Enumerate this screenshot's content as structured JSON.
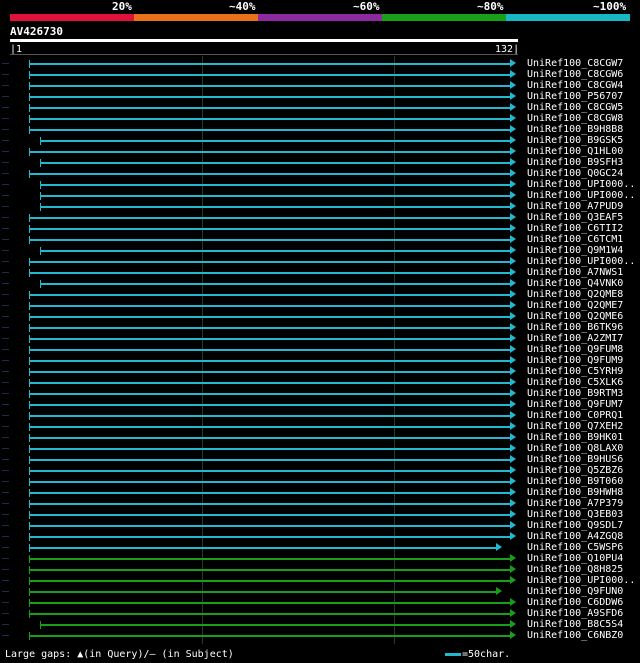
{
  "legend": {
    "labels": [
      "20%",
      "~40%",
      "~60%",
      "~80%",
      "~100%"
    ],
    "colors": [
      "#e0123c",
      "#e8711a",
      "#8e2aa0",
      "#18a118",
      "#17b7c5"
    ]
  },
  "query": {
    "id": "AV426730",
    "start": "1",
    "end": "132"
  },
  "hits": [
    {
      "label": "UniRef100_C8CGW7",
      "color": "cyan",
      "start": "near"
    },
    {
      "label": "UniRef100_C8CGW6",
      "color": "cyan",
      "start": "near"
    },
    {
      "label": "UniRef100_C8CGW4",
      "color": "cyan",
      "start": "near"
    },
    {
      "label": "UniRef100_P56707",
      "color": "cyan",
      "start": "near"
    },
    {
      "label": "UniRef100_C8CGW5",
      "color": "cyan",
      "start": "near"
    },
    {
      "label": "UniRef100_C8CGW8",
      "color": "cyan",
      "start": "near"
    },
    {
      "label": "UniRef100_B9H8B8",
      "color": "cyan",
      "start": "near"
    },
    {
      "label": "UniRef100_B9GSK5",
      "color": "cyan",
      "start": "far"
    },
    {
      "label": "UniRef100_Q1HL00",
      "color": "cyan",
      "start": "near"
    },
    {
      "label": "UniRef100_B9SFH3",
      "color": "cyan",
      "start": "far"
    },
    {
      "label": "UniRef100_Q0GC24",
      "color": "cyan",
      "start": "near"
    },
    {
      "label": "UniRef100_UPI000..",
      "color": "cyan",
      "start": "far"
    },
    {
      "label": "UniRef100_UPI000..",
      "color": "cyan",
      "start": "far"
    },
    {
      "label": "UniRef100_A7PUD9",
      "color": "cyan",
      "start": "far"
    },
    {
      "label": "UniRef100_Q3EAF5",
      "color": "cyan",
      "start": "near"
    },
    {
      "label": "UniRef100_C6TII2",
      "color": "cyan",
      "start": "near"
    },
    {
      "label": "UniRef100_C6TCM1",
      "color": "cyan",
      "start": "near"
    },
    {
      "label": "UniRef100_Q9M1W4",
      "color": "cyan",
      "start": "far"
    },
    {
      "label": "UniRef100_UPI000..",
      "color": "cyan",
      "start": "near"
    },
    {
      "label": "UniRef100_A7NWS1",
      "color": "cyan",
      "start": "near"
    },
    {
      "label": "UniRef100_Q4VNK0",
      "color": "cyan",
      "start": "far"
    },
    {
      "label": "UniRef100_Q2QME8",
      "color": "cyan",
      "start": "near"
    },
    {
      "label": "UniRef100_Q2QME7",
      "color": "cyan",
      "start": "near"
    },
    {
      "label": "UniRef100_Q2QME6",
      "color": "cyan",
      "start": "near"
    },
    {
      "label": "UniRef100_B6TK96",
      "color": "cyan",
      "start": "near"
    },
    {
      "label": "UniRef100_A2ZMI7",
      "color": "cyan",
      "start": "near"
    },
    {
      "label": "UniRef100_Q9FUM8",
      "color": "cyan",
      "start": "near"
    },
    {
      "label": "UniRef100_Q9FUM9",
      "color": "cyan",
      "start": "near"
    },
    {
      "label": "UniRef100_C5YRH9",
      "color": "cyan",
      "start": "near"
    },
    {
      "label": "UniRef100_C5XLK6",
      "color": "cyan",
      "start": "near"
    },
    {
      "label": "UniRef100_B9RTM3",
      "color": "cyan",
      "start": "near"
    },
    {
      "label": "UniRef100_Q9FUM7",
      "color": "cyan",
      "start": "near"
    },
    {
      "label": "UniRef100_C0PRQ1",
      "color": "cyan",
      "start": "near"
    },
    {
      "label": "UniRef100_Q7XEH2",
      "color": "cyan",
      "start": "near"
    },
    {
      "label": "UniRef100_B9HK01",
      "color": "cyan",
      "start": "near"
    },
    {
      "label": "UniRef100_Q8LAX0",
      "color": "cyan",
      "start": "near"
    },
    {
      "label": "UniRef100_B9HUS6",
      "color": "cyan",
      "start": "near"
    },
    {
      "label": "UniRef100_Q5ZBZ6",
      "color": "cyan",
      "start": "near"
    },
    {
      "label": "UniRef100_B9T060",
      "color": "cyan",
      "start": "near"
    },
    {
      "label": "UniRef100_B9HWH8",
      "color": "cyan",
      "start": "near"
    },
    {
      "label": "UniRef100_A7P379",
      "color": "cyan",
      "start": "near"
    },
    {
      "label": "UniRef100_Q3EB03",
      "color": "cyan",
      "start": "near"
    },
    {
      "label": "UniRef100_Q9SDL7",
      "color": "cyan",
      "start": "near"
    },
    {
      "label": "UniRef100_A4ZGQ8",
      "color": "cyan",
      "start": "near"
    },
    {
      "label": "UniRef100_C5WSP6",
      "color": "cyan",
      "start": "near",
      "short": true
    },
    {
      "label": "UniRef100_Q10PU4",
      "color": "green",
      "start": "near"
    },
    {
      "label": "UniRef100_Q8H825",
      "color": "green",
      "start": "near"
    },
    {
      "label": "UniRef100_UPI000..",
      "color": "green",
      "start": "near"
    },
    {
      "label": "UniRef100_Q9FUN0",
      "color": "green",
      "start": "near",
      "short": true
    },
    {
      "label": "UniRef100_C6DDW6",
      "color": "green",
      "start": "near"
    },
    {
      "label": "UniRef100_A9SFD6",
      "color": "green",
      "start": "near"
    },
    {
      "label": "UniRef100_B8C5S4",
      "color": "green",
      "start": "far"
    },
    {
      "label": "UniRef100_C6NBZ0",
      "color": "green",
      "start": "near"
    }
  ],
  "footer": {
    "gaps_text": "Large gaps: ▲(in Query)/– (in Subject)",
    "scale_text": "=50char."
  },
  "palette": {
    "cyan": "#22b8cf",
    "green": "#1a9e1a"
  }
}
